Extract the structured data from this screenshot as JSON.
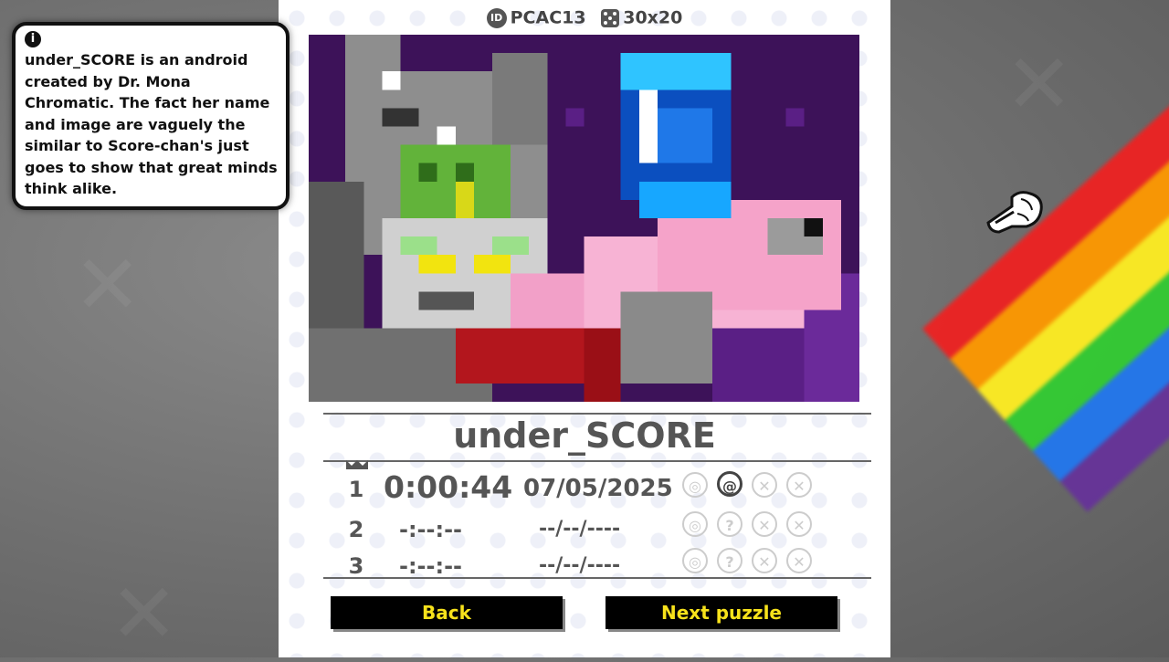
{
  "header": {
    "id_icon": "ID",
    "id_value": "PCAC13",
    "size_value": "30x20"
  },
  "puzzle": {
    "title": "under_SCORE",
    "art_grid": {
      "cols": 30,
      "rows": 20
    }
  },
  "records": [
    {
      "rank": "1",
      "time": "0:00:44",
      "date": "07/05/2025",
      "best": true
    },
    {
      "rank": "2",
      "time": "-:--:--",
      "date": "--/--/----",
      "best": false
    },
    {
      "rank": "3",
      "time": "-:--:--",
      "date": "--/--/----",
      "best": false
    }
  ],
  "status_icons": [
    "target-icon",
    "hint-icon",
    "mistake-icon",
    "cross-icon"
  ],
  "buttons": {
    "back": "Back",
    "next": "Next puzzle"
  },
  "info": {
    "icon": "i",
    "text": "under_SCORE is an android created by Dr. Mona Chromatic. The fact her name and image are vaguely the similar to Score-chan's just goes to show that great minds think alike."
  },
  "colors": {
    "button_bg": "#000000",
    "button_text": "#f7e21b",
    "art_bg": "#3d1259"
  }
}
